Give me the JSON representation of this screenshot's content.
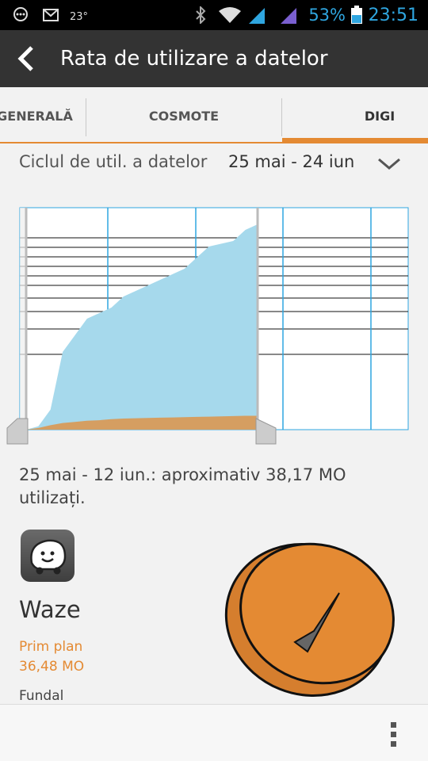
{
  "status_bar": {
    "temperature": "23°",
    "battery_percent": "53%",
    "time": "23:51",
    "signal_icons": [
      "message-icon",
      "gmail-icon",
      "bluetooth-icon",
      "wifi-icon",
      "signal-1-icon",
      "signal-2-icon",
      "battery-icon"
    ]
  },
  "header": {
    "title": "Rata de utilizare a datelor",
    "back_icon": "back-icon"
  },
  "tabs": [
    {
      "label": "GENERALĂ",
      "selected": false
    },
    {
      "label": "COSMOTE",
      "selected": false
    },
    {
      "label": "DIGI",
      "selected": true
    }
  ],
  "cycle": {
    "label": "Ciclul de util. a datelor",
    "value": "25 mai - 24 iun"
  },
  "summary": "25 mai - 12 iun.: aproximativ 38,17 MO utilizați.",
  "app": {
    "name": "Waze",
    "foreground_label": "Prim plan",
    "foreground_value": "36,48 MO",
    "background_label": "Fundal"
  },
  "chart_data": {
    "type": "area",
    "series": [
      {
        "values": [
          0,
          0.6,
          3.6,
          14,
          17,
          20,
          21,
          22,
          24,
          25,
          26,
          27,
          28,
          29,
          31,
          33,
          33.5,
          34,
          36,
          37
        ]
      },
      {
        "values": [
          0,
          0.3,
          0.8,
          1.2,
          1.4,
          1.6,
          1.7,
          1.9,
          2.0,
          2.05,
          2.1,
          2.15,
          2.2,
          2.25,
          2.3,
          2.35,
          2.4,
          2.45,
          2.5,
          2.5
        ]
      }
    ],
    "colors": {
      "total": "#a6d9ec",
      "foreground": "#e48a33"
    },
    "max_value": 40
  },
  "pie_data": {
    "foreground_fraction": 0.956,
    "colors": {
      "foreground": "#e48a33",
      "background": "#666666"
    }
  }
}
